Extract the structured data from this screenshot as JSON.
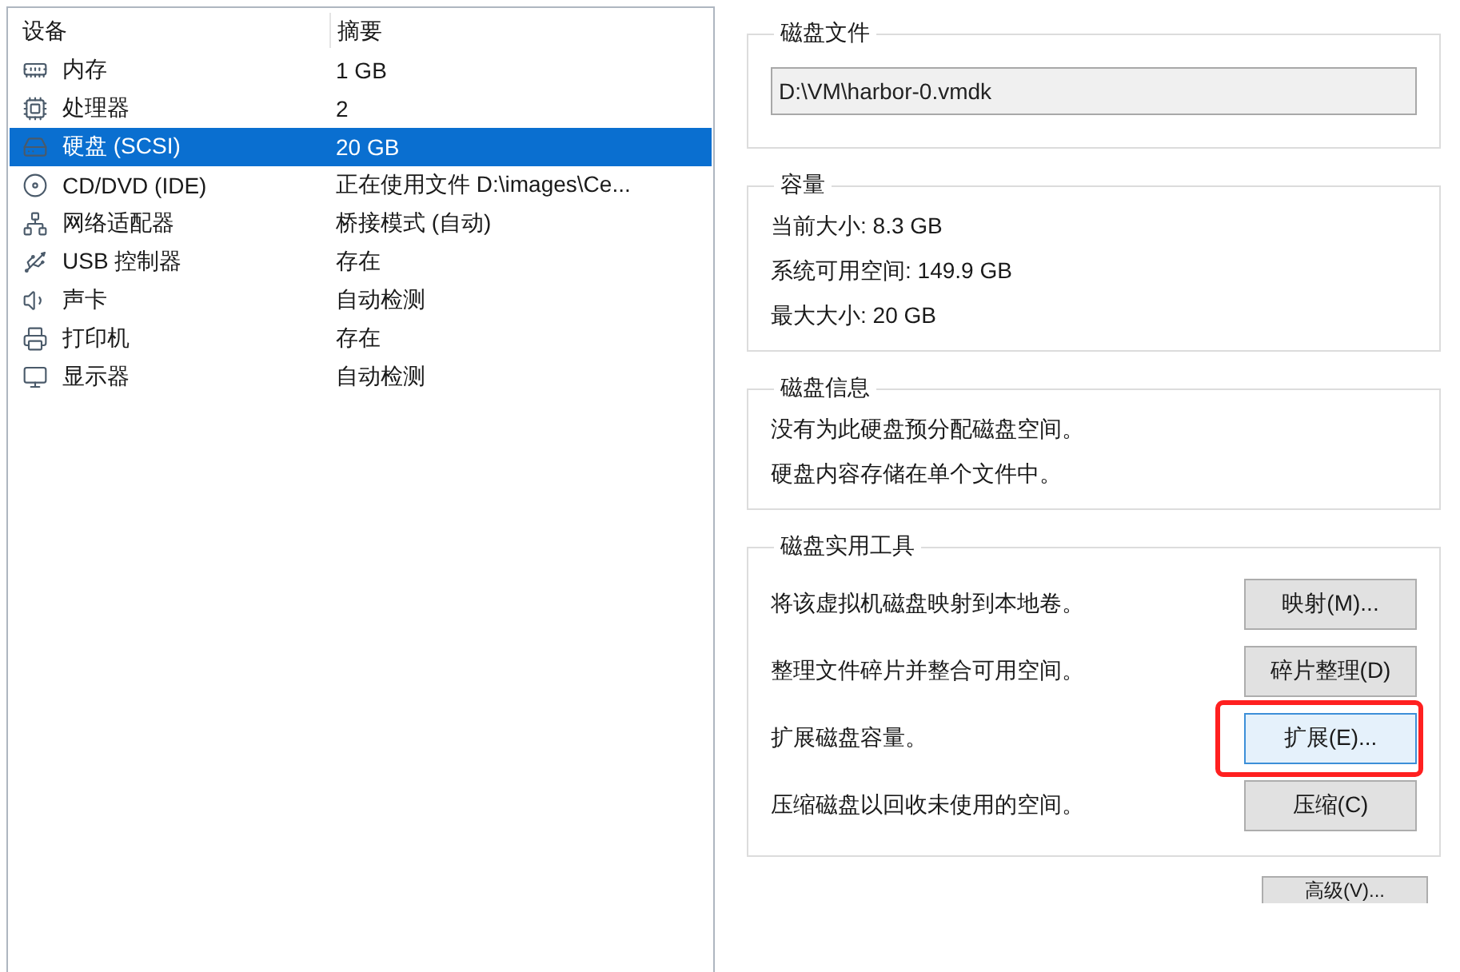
{
  "device_table": {
    "columns": [
      "设备",
      "摘要"
    ],
    "rows": [
      {
        "kind": "memory",
        "device": "内存",
        "summary": "1 GB",
        "selected": false
      },
      {
        "kind": "processor",
        "device": "处理器",
        "summary": "2",
        "selected": false
      },
      {
        "kind": "disk",
        "device": "硬盘 (SCSI)",
        "summary": "20 GB",
        "selected": true
      },
      {
        "kind": "cd",
        "device": "CD/DVD (IDE)",
        "summary": "正在使用文件 D:\\images\\Ce...",
        "selected": false
      },
      {
        "kind": "network",
        "device": "网络适配器",
        "summary": "桥接模式 (自动)",
        "selected": false
      },
      {
        "kind": "usb",
        "device": "USB 控制器",
        "summary": "存在",
        "selected": false
      },
      {
        "kind": "sound",
        "device": "声卡",
        "summary": "自动检测",
        "selected": false
      },
      {
        "kind": "printer",
        "device": "打印机",
        "summary": "存在",
        "selected": false
      },
      {
        "kind": "display",
        "device": "显示器",
        "summary": "自动检测",
        "selected": false
      }
    ]
  },
  "disk_file": {
    "title": "磁盘文件",
    "value": "D:\\VM\\harbor-0.vmdk"
  },
  "capacity": {
    "title": "容量",
    "lines": [
      "当前大小: 8.3 GB",
      "系统可用空间: 149.9 GB",
      "最大大小: 20 GB"
    ]
  },
  "disk_info": {
    "title": "磁盘信息",
    "lines": [
      "没有为此硬盘预分配磁盘空间。",
      "硬盘内容存储在单个文件中。"
    ]
  },
  "disk_utilities": {
    "title": "磁盘实用工具",
    "items": [
      {
        "text": "将该虚拟机磁盘映射到本地卷。",
        "button": "映射(M)...",
        "focused": false,
        "highlighted": false
      },
      {
        "text": "整理文件碎片并整合可用空间。",
        "button": "碎片整理(D)",
        "focused": false,
        "highlighted": false
      },
      {
        "text": "扩展磁盘容量。",
        "button": "扩展(E)...",
        "focused": true,
        "highlighted": true
      },
      {
        "text": "压缩磁盘以回收未使用的空间。",
        "button": "压缩(C)",
        "focused": false,
        "highlighted": false
      }
    ]
  },
  "advanced_button": "高级(V)..."
}
